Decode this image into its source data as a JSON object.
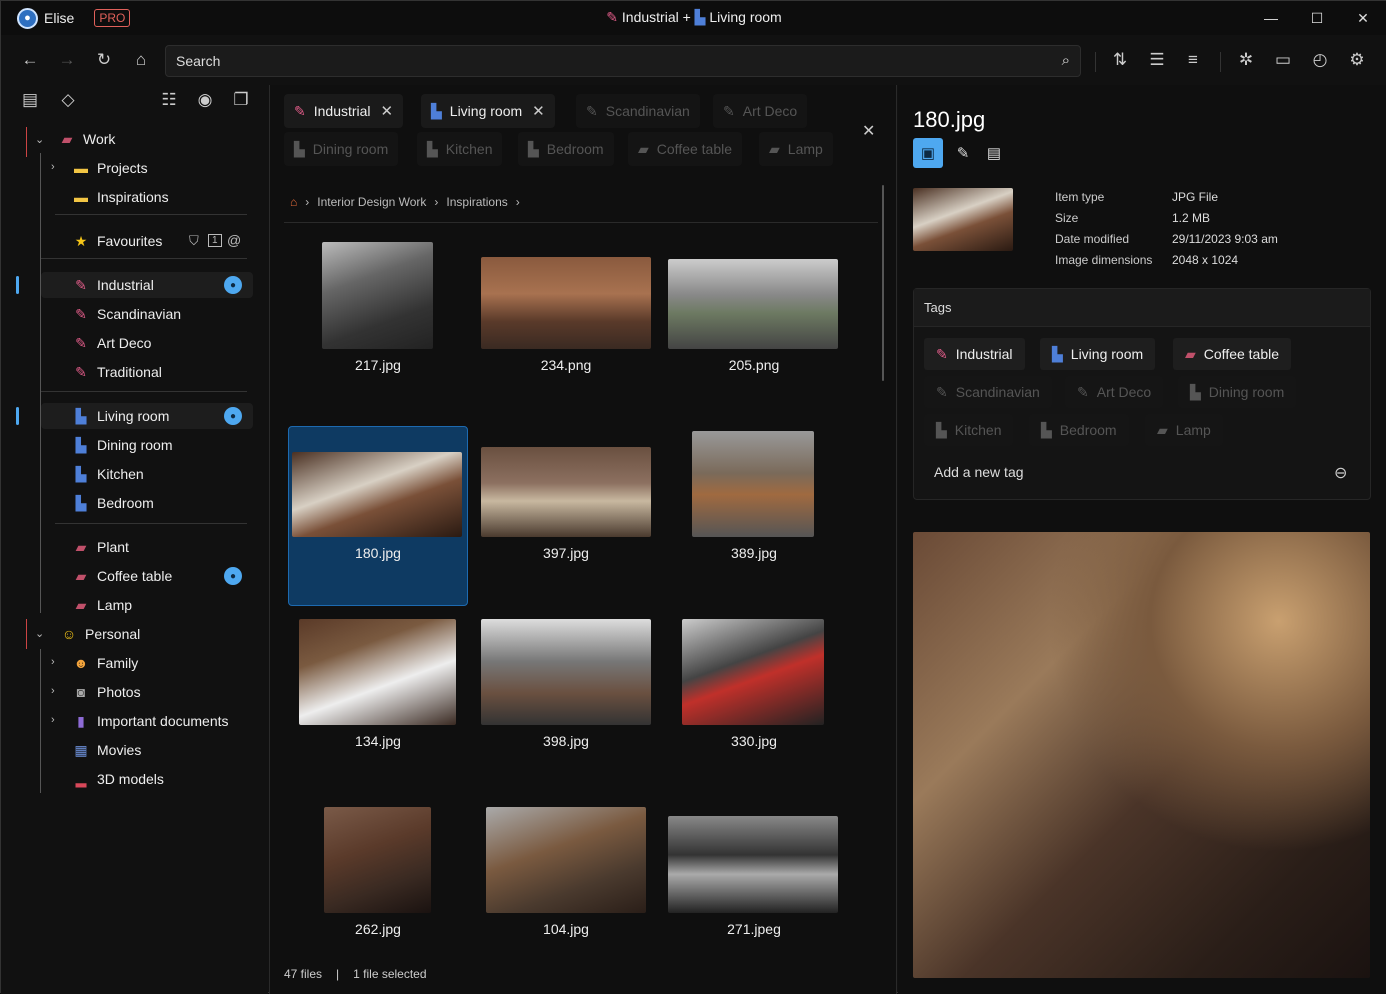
{
  "titlebar": {
    "user": "Elise",
    "badge": "PRO",
    "title_left": "Industrial +",
    "title_right": "Living room"
  },
  "toolbar": {
    "search_placeholder": "Search"
  },
  "sidebar": {
    "work": "Work",
    "projects": "Projects",
    "inspirations": "Inspirations",
    "favourites": "Favourites",
    "industrial": "Industrial",
    "scandinavian": "Scandinavian",
    "art_deco": "Art Deco",
    "traditional": "Traditional",
    "living_room": "Living room",
    "dining_room": "Dining room",
    "kitchen": "Kitchen",
    "bedroom": "Bedroom",
    "plant": "Plant",
    "coffee_table": "Coffee table",
    "lamp": "Lamp",
    "personal": "Personal",
    "family": "Family",
    "photos": "Photos",
    "important": "Important documents",
    "movies": "Movies",
    "models": "3D models",
    "fav_badge": "1"
  },
  "filter_tags": {
    "active": [
      "Industrial",
      "Living room"
    ],
    "inactive_row1": [
      "Scandinavian",
      "Art Deco"
    ],
    "inactive_row2": [
      "Dining room",
      "Kitchen",
      "Bedroom",
      "Coffee table",
      "Lamp"
    ]
  },
  "breadcrumb": [
    "Interior Design Work",
    "Inspirations"
  ],
  "files": [
    "217.jpg",
    "234.png",
    "205.png",
    "180.jpg",
    "397.jpg",
    "389.jpg",
    "134.jpg",
    "398.jpg",
    "330.jpg",
    "262.jpg",
    "104.jpg",
    "271.jpeg"
  ],
  "status": {
    "count": "47 files",
    "sep": "|",
    "selected": "1 file selected"
  },
  "preview": {
    "title": "180.jpg",
    "labels": [
      "Item type",
      "Size",
      "Date modified",
      "Image dimensions"
    ],
    "values": [
      "JPG File",
      "1.2 MB",
      "29/11/2023 9:03 am",
      "2048 x 1024"
    ],
    "tags_header": "Tags",
    "active_tags": [
      "Industrial",
      "Living room",
      "Coffee table"
    ],
    "inactive_tags": [
      "Scandinavian",
      "Art Deco",
      "Dining room",
      "Kitchen",
      "Bedroom",
      "Lamp"
    ],
    "add_tag": "Add a new tag"
  }
}
